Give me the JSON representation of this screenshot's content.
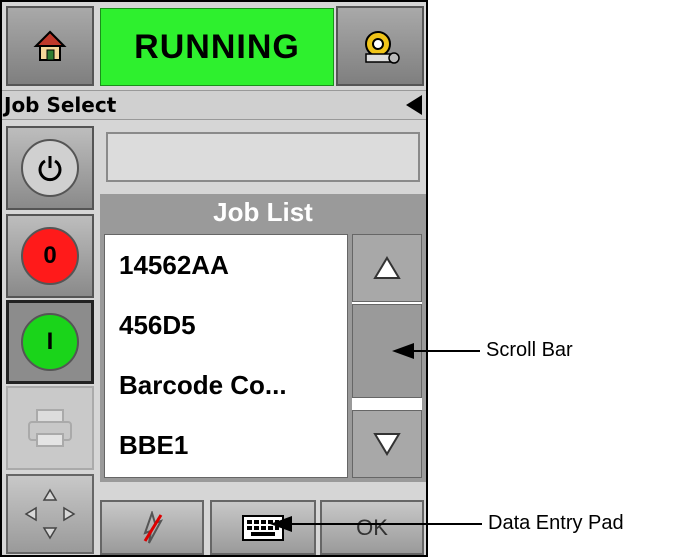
{
  "header": {
    "status": "RUNNING",
    "status_color": "#2ef02e",
    "home_icon": "home-icon",
    "settings_icon": "settings-gear-icon"
  },
  "titlebar": {
    "title": "Job Select"
  },
  "side": {
    "power_icon": "power-icon",
    "stop_label": "0",
    "start_label": "I",
    "printer_icon": "printer-icon",
    "nav_icon": "navigation-arrows-icon"
  },
  "entry": {
    "value": ""
  },
  "joblist": {
    "title": "Job List",
    "items": [
      "14562AA",
      "456D5",
      "Barcode Co...",
      "BBE1"
    ]
  },
  "bottom": {
    "ok_label": "OK",
    "keyboard_icon": "keyboard-icon",
    "cancel_icon": "cancel-icon"
  },
  "callouts": {
    "scroll_bar": "Scroll Bar",
    "data_entry_pad": "Data Entry Pad"
  }
}
